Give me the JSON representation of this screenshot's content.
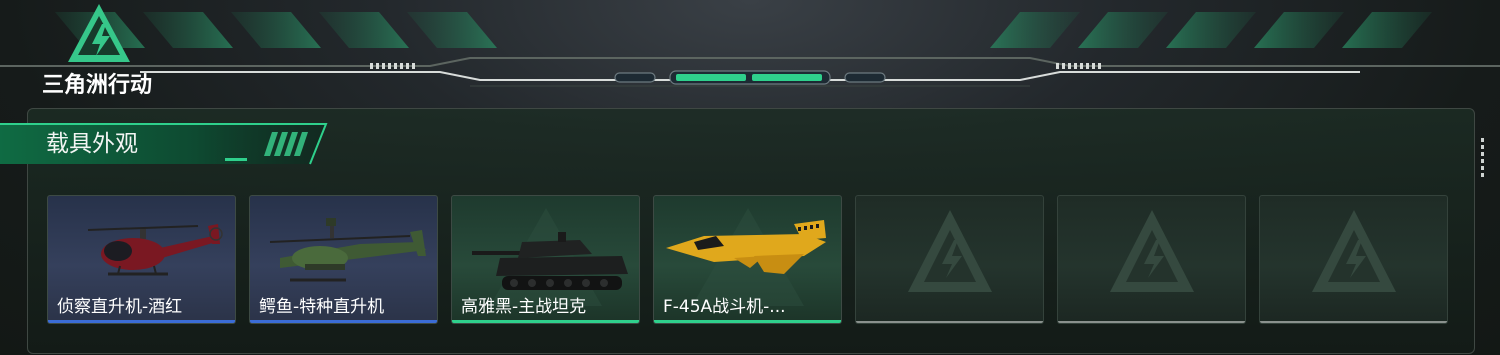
{
  "game": {
    "logo_text": "三角洲行动"
  },
  "section": {
    "title": "载具外观"
  },
  "colors": {
    "accent_green": "#2fd08c",
    "rarity_blue": "#3b6cd6",
    "empty_line": "#8a918d"
  },
  "vehicles": [
    {
      "name": "侦察直升机-酒红",
      "rarity": "blue",
      "icon": "red-scout-helicopter-icon"
    },
    {
      "name": "鳄鱼-特种直升机",
      "rarity": "blue",
      "icon": "attack-helicopter-icon"
    },
    {
      "name": "高雅黑-主战坦克",
      "rarity": "green",
      "icon": "black-main-battle-tank-icon"
    },
    {
      "name": "F-45A战斗机-...",
      "rarity": "green",
      "icon": "yellow-fighter-jet-icon"
    },
    {
      "name": "",
      "rarity": "empty",
      "icon": "empty-slot-logo-icon"
    },
    {
      "name": "",
      "rarity": "empty",
      "icon": "empty-slot-logo-icon"
    },
    {
      "name": "",
      "rarity": "empty",
      "icon": "empty-slot-logo-icon"
    }
  ]
}
